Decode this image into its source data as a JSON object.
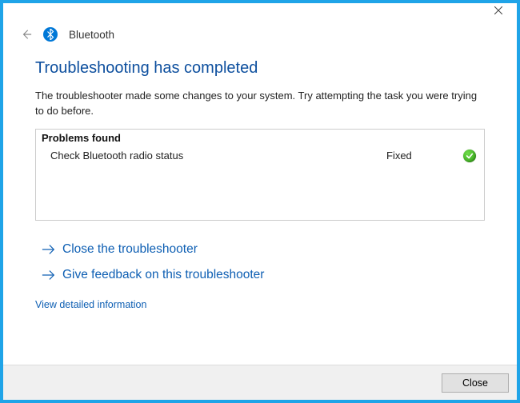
{
  "header": {
    "title": "Bluetooth"
  },
  "main": {
    "heading": "Troubleshooting has completed",
    "description": "The troubleshooter made some changes to your system. Try attempting the task you were trying to do before."
  },
  "problems": {
    "header": "Problems found",
    "items": [
      {
        "name": "Check Bluetooth radio status",
        "status": "Fixed"
      }
    ]
  },
  "actions": {
    "close_troubleshooter": "Close the troubleshooter",
    "give_feedback": "Give feedback on this troubleshooter",
    "view_detailed": "View detailed information"
  },
  "footer": {
    "close_button": "Close"
  }
}
